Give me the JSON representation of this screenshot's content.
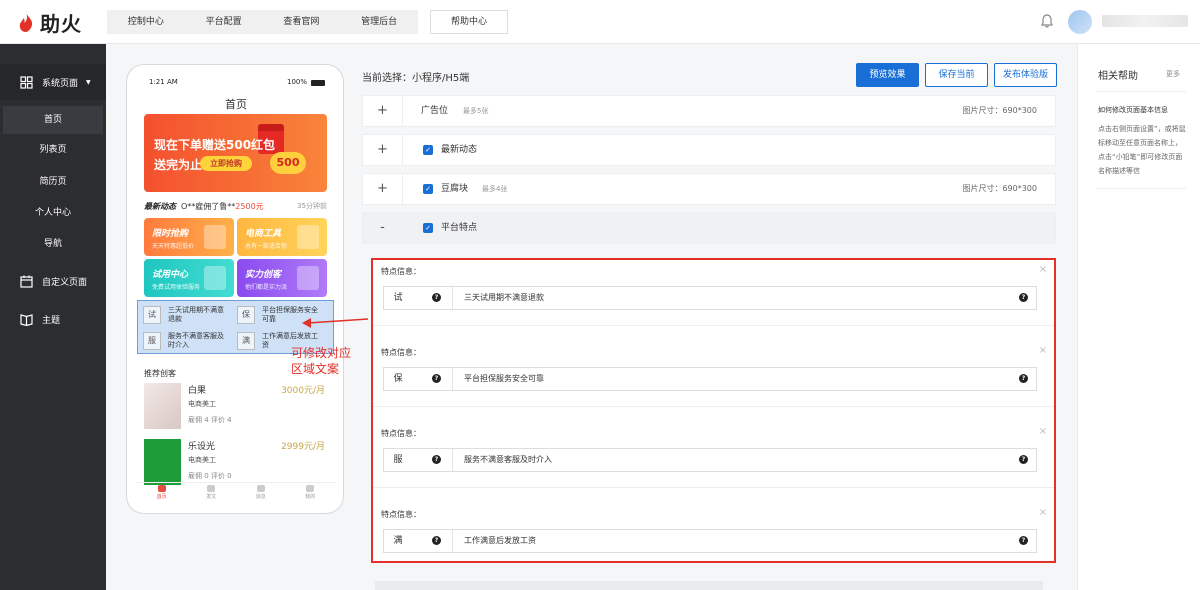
{
  "app": {
    "brand": "助火",
    "brand_color": "#e3312a"
  },
  "topnav": {
    "items": [
      "控制中心",
      "平台配置",
      "查看官网",
      "管理后台"
    ],
    "help": "帮助中心"
  },
  "sidebar": {
    "system_pages": "系统页面",
    "sub_items": [
      "首页",
      "列表页",
      "简历页",
      "个人中心",
      "导航"
    ],
    "custom_pages": "自定义页面",
    "theme": "主题"
  },
  "phone": {
    "time": "1:21 AM",
    "battery": "100%",
    "title": "首页",
    "banner": {
      "line1": "现在下单赠送500红包",
      "line2": "送完为止",
      "button": "立即抢购",
      "amount": "500"
    },
    "news": {
      "label": "最新动态",
      "text_prefix": "O**雇佣了鲁**",
      "amount": "2500元",
      "time": "35分钟前"
    },
    "cards": [
      {
        "title": "限时抢购",
        "sub": "天天特惠超低价"
      },
      {
        "title": "电商工具",
        "sub": "总有一款适合你"
      },
      {
        "title": "试用中心",
        "sub": "免费试用体验服务"
      },
      {
        "title": "实力创客",
        "sub": "他们都是实力派"
      }
    ],
    "features": [
      {
        "badge": "试",
        "text": "三天试用期不满意退款"
      },
      {
        "badge": "保",
        "text": "平台担保服务安全可靠"
      },
      {
        "badge": "服",
        "text": "服务不满意客服及时介入"
      },
      {
        "badge": "满",
        "text": "工作满意后发放工资"
      }
    ],
    "recommend_title": "推荐创客",
    "recommend": [
      {
        "name": "白果",
        "price": "3000元/月",
        "role": "电商美工",
        "stats": "雇佣 4  评价 4"
      },
      {
        "name": "乐设光",
        "price": "2999元/月",
        "role": "电商美工",
        "stats": "雇佣 0  评价 0"
      }
    ],
    "tabs": [
      "首页",
      "发文",
      "消息",
      "我的"
    ]
  },
  "annotation": {
    "text": "可修改对应区域文案"
  },
  "editor": {
    "current_selection": "当前选择：小程序/H5端",
    "buttons": {
      "preview": "预览效果",
      "save": "保存当前",
      "publish": "发布体验版"
    },
    "rows": [
      {
        "toggle": "+",
        "label": "广告位",
        "hint": "最多5张",
        "size": "图片尺寸：690*300",
        "checked": false
      },
      {
        "toggle": "+",
        "label": "最新动态",
        "hint": "",
        "size": "",
        "checked": true
      },
      {
        "toggle": "+",
        "label": "豆腐块",
        "hint": "最多4张",
        "size": "图片尺寸：690*300",
        "checked": true
      },
      {
        "toggle": "-",
        "label": "平台特点",
        "hint": "",
        "size": "",
        "checked": true
      }
    ],
    "feature_label": "特点信息：",
    "feature_items": [
      {
        "key": "试",
        "value": "三天试用期不满意退款"
      },
      {
        "key": "保",
        "value": "平台担保服务安全可靠"
      },
      {
        "key": "服",
        "value": "服务不满意客服及时介入"
      },
      {
        "key": "满",
        "value": "工作满意后发放工资"
      }
    ]
  },
  "help_panel": {
    "title": "相关帮助",
    "more": "更多",
    "article_title": "如何修改页面基本信息",
    "article_body": "点击右侧页面设置”，或将鼠标移动至任意页面名称上，点击“小铅笔”即可修改页面名称描述等信"
  },
  "colors": {
    "primary": "#1a6fd6",
    "annotation_red": "#e3312a",
    "sidebar_bg": "#2c2d31"
  },
  "icons": [
    "fire-logo-icon",
    "bell-icon",
    "grid-icon",
    "calendar-icon",
    "book-icon",
    "question-icon",
    "close-icon",
    "home-tab-icon"
  ]
}
